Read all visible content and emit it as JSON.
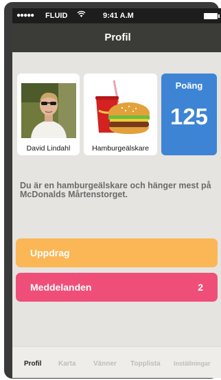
{
  "status_bar": {
    "signal": "●●●●●",
    "carrier": "FLUID",
    "wifi_icon": "wifi-icon",
    "time": "9:41 A.M",
    "battery_icon": "battery-icon"
  },
  "nav": {
    "title": "Profil"
  },
  "cards": {
    "user": {
      "name": "David Lindahl",
      "image": "user-photo"
    },
    "badge": {
      "name": "Hamburgeälskare",
      "image": "burger-soda-illustration"
    },
    "points": {
      "label": "Poäng",
      "value": "125",
      "color": "#3d84d4"
    }
  },
  "description": "Du är en hamburgeälskare och hänger mest på McDonalds Mårtenstorget.",
  "rows": {
    "uppdrag": {
      "label": "Uppdrag",
      "color": "#fbb655"
    },
    "meddelanden": {
      "label": "Meddelanden",
      "count": "2",
      "color": "#ef4e79"
    }
  },
  "tabs": [
    {
      "label": "Profil",
      "active": true
    },
    {
      "label": "Karta",
      "active": false
    },
    {
      "label": "Vänner",
      "active": false
    },
    {
      "label": "Topplista",
      "active": false
    },
    {
      "label": "Inställningar",
      "active": false
    }
  ]
}
